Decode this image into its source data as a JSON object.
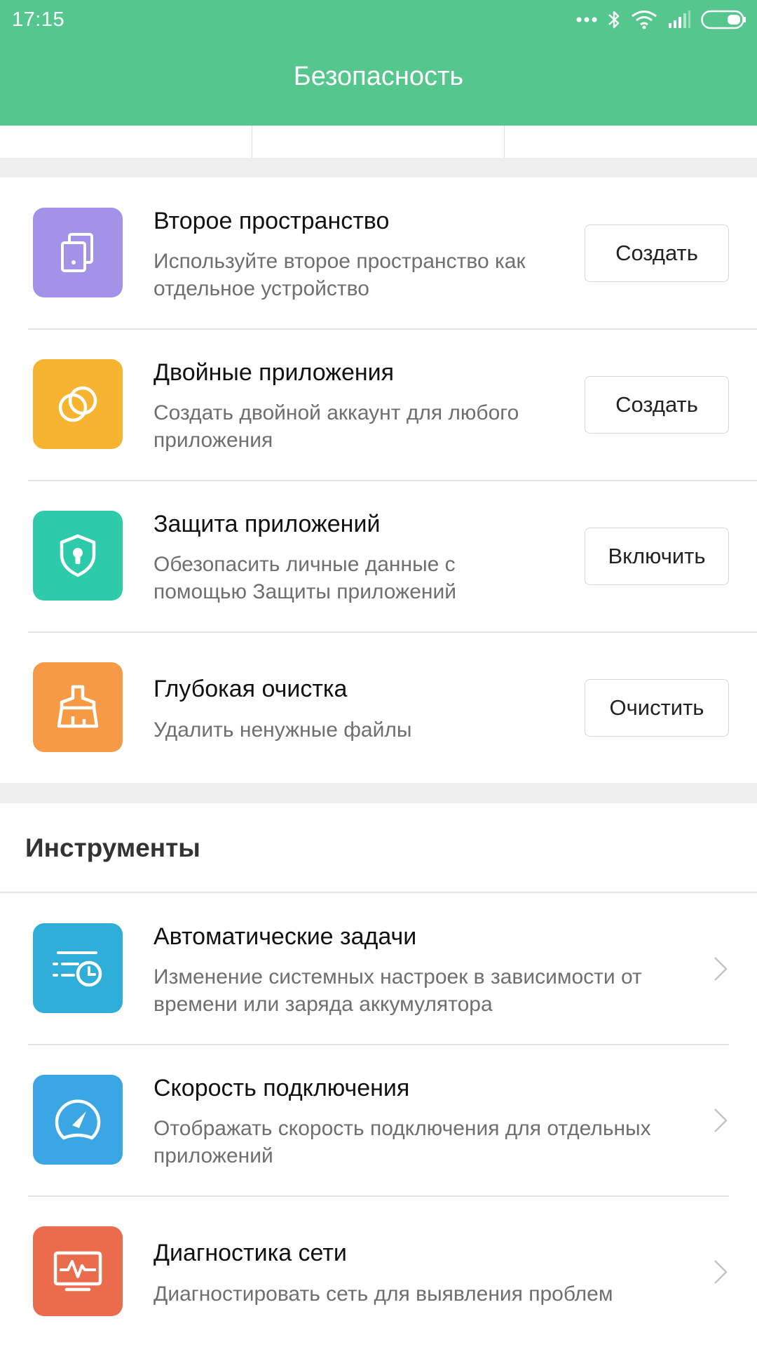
{
  "status_bar": {
    "time": "17:15",
    "icons": [
      "more-dots-icon",
      "bluetooth-icon",
      "wifi-icon",
      "signal-icon",
      "battery-icon"
    ]
  },
  "header": {
    "title": "Безопасность",
    "color": "#55c78e"
  },
  "features": [
    {
      "title": "Второе пространство",
      "desc_lines": [
        "Используйте второе пространство как",
        "отдельное устройство"
      ],
      "button": "Создать",
      "icon": "second-space-icon",
      "color": "#a293e8"
    },
    {
      "title": "Двойные приложения",
      "desc_lines": [
        "Создать двойной аккаунт для любого",
        "приложения"
      ],
      "button": "Создать",
      "icon": "dual-apps-icon",
      "color": "#f6b431"
    },
    {
      "title": "Защита приложений",
      "desc_lines": [
        "Обезопасить личные данные с",
        "помощью Защиты приложений"
      ],
      "button": "Включить",
      "icon": "app-lock-shield-icon",
      "color": "#2ecbab"
    },
    {
      "title": "Глубокая очистка",
      "desc_lines": [
        "Удалить ненужные файлы"
      ],
      "button": "Очистить",
      "icon": "deep-clean-broom-icon",
      "color": "#f69a45"
    }
  ],
  "tools": {
    "section_title": "Инструменты",
    "items": [
      {
        "title": "Автоматические задачи",
        "desc_lines": [
          "Изменение системных настроек в зависимости от",
          "времени или заряда аккумулятора"
        ],
        "icon": "scheduled-tasks-icon",
        "color": "#2faed9"
      },
      {
        "title": "Скорость подключения",
        "desc_lines": [
          "Отображать скорость подключения для отдельных",
          "приложений"
        ],
        "icon": "speedometer-icon",
        "color": "#3aa6e3"
      },
      {
        "title": "Диагностика сети",
        "desc_lines": [
          "Диагностировать сеть для выявления проблем"
        ],
        "icon": "network-diagnostics-icon",
        "color": "#ea6c4c"
      }
    ]
  }
}
